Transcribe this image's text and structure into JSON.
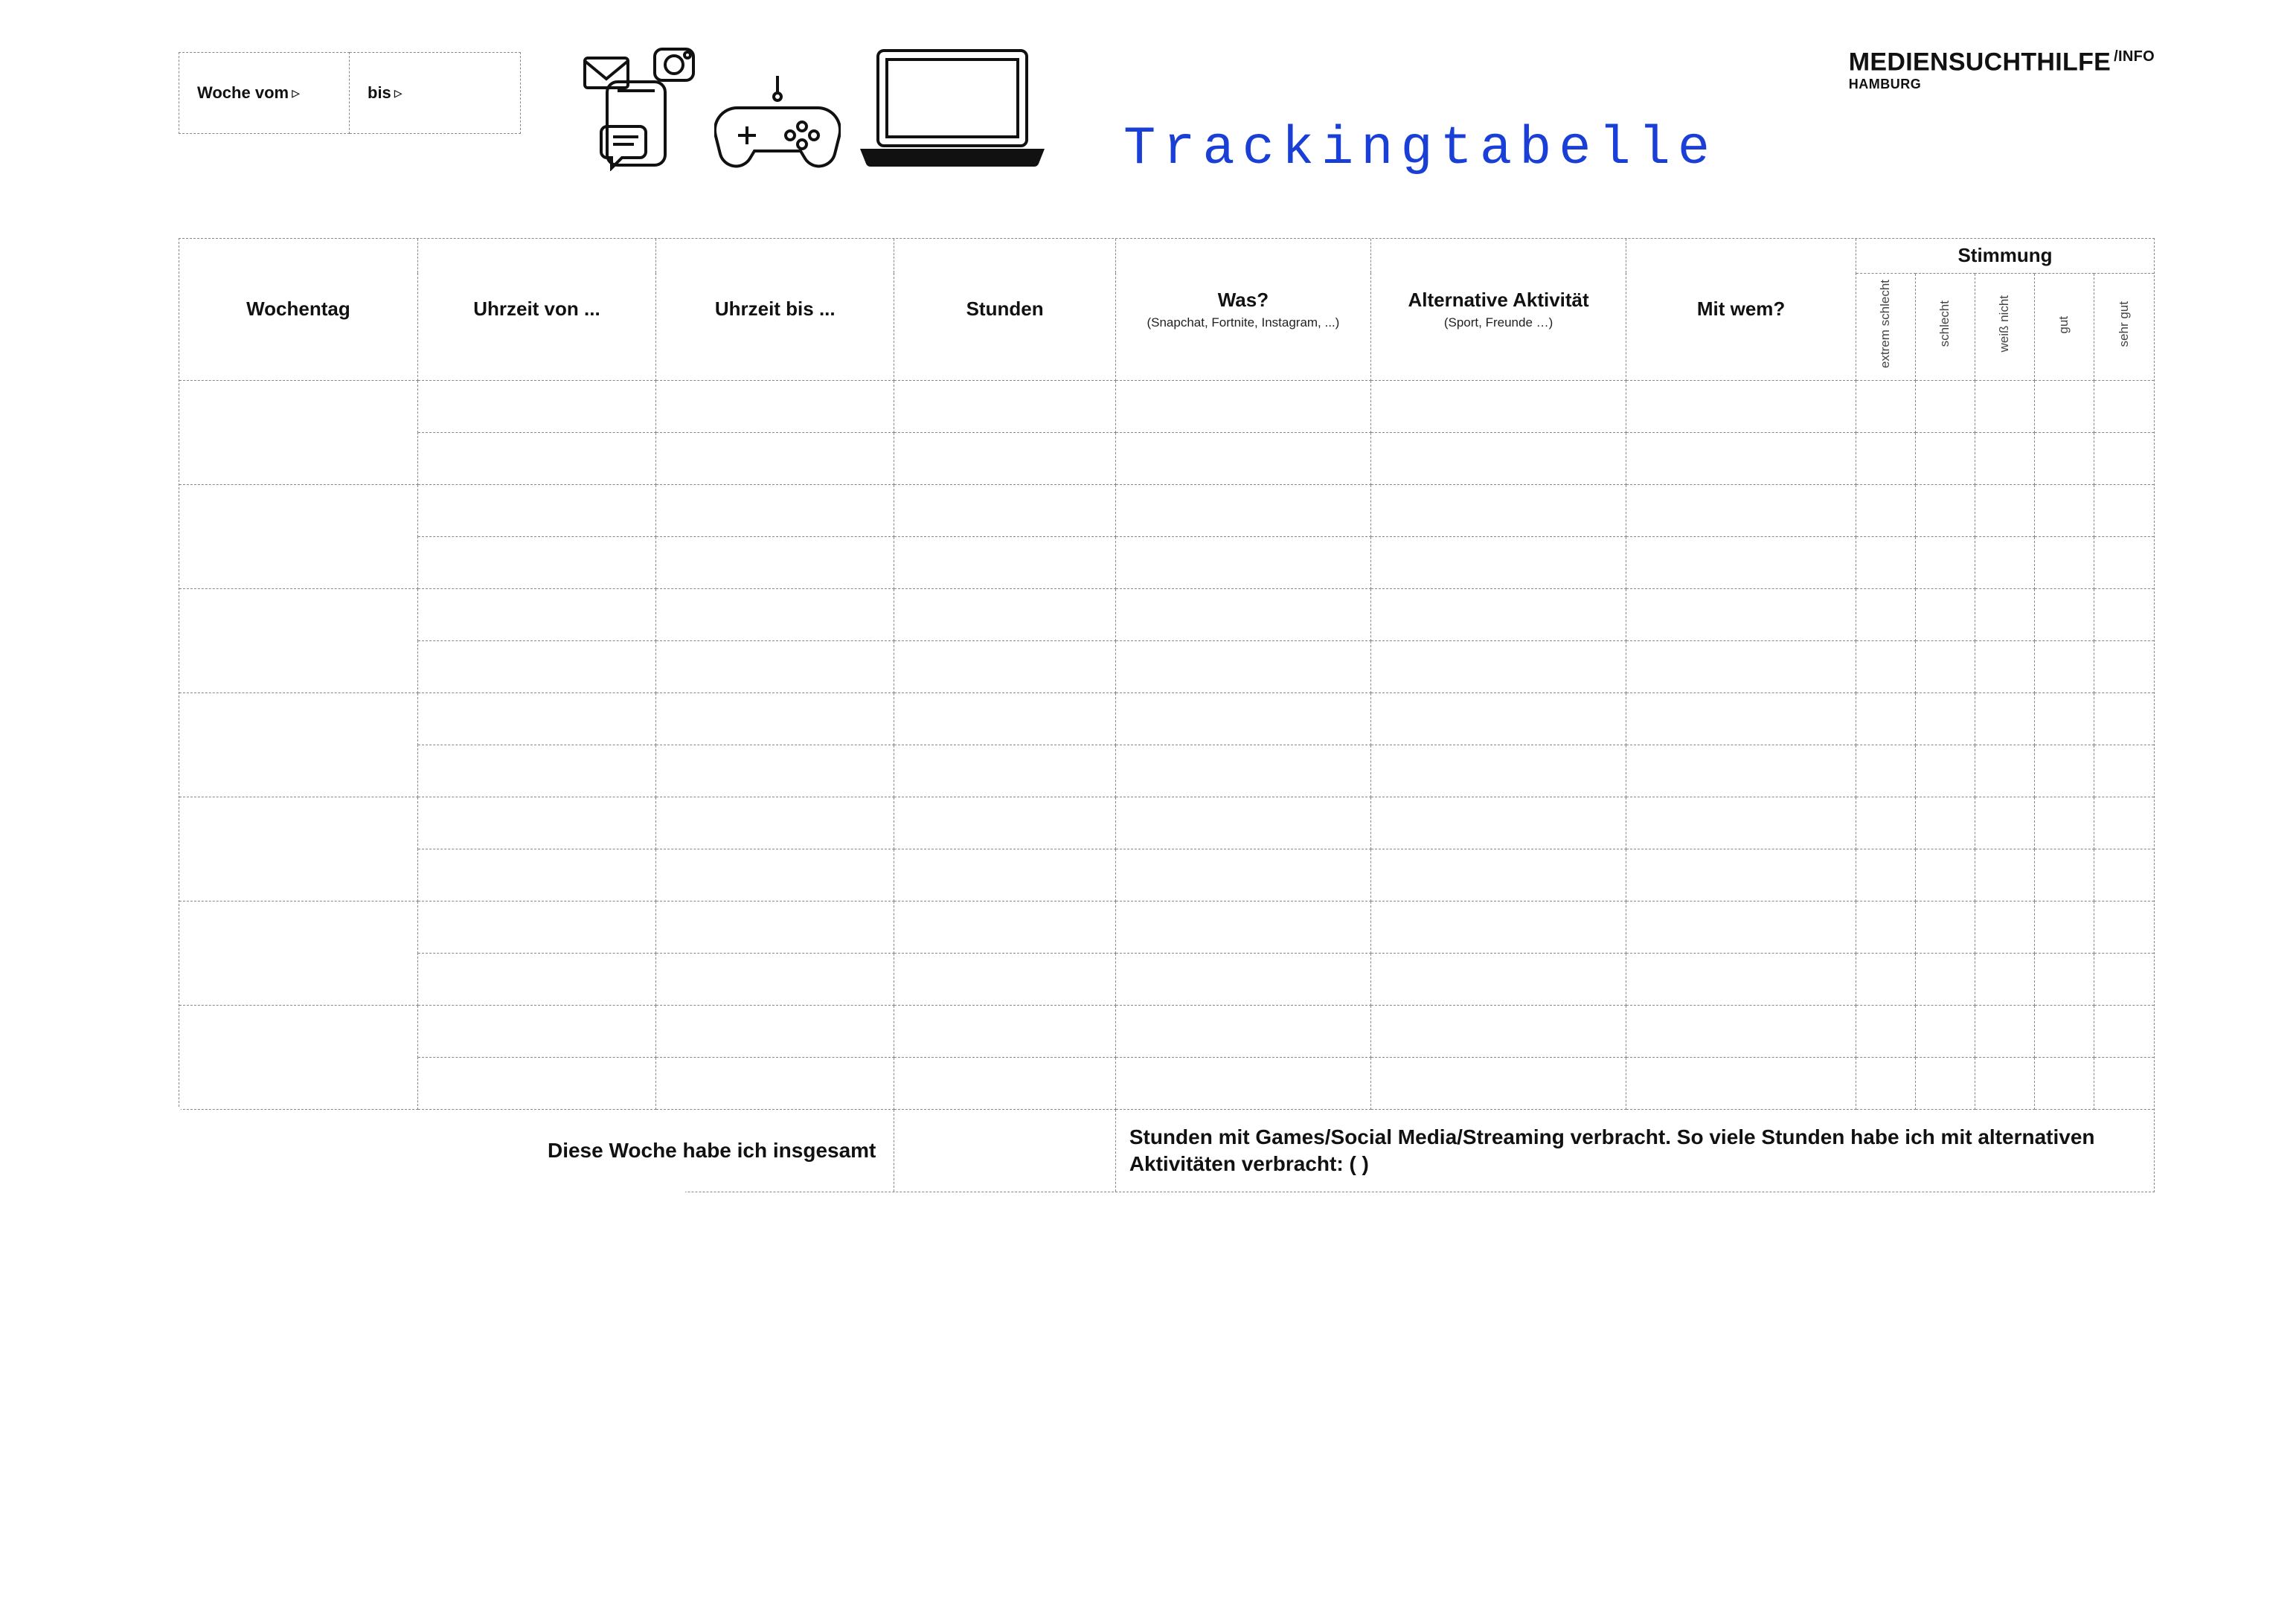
{
  "brand": {
    "name": "MEDIENSUCHTHILFE",
    "suffix": "/INFO",
    "city": "HAMBURG"
  },
  "title": "Trackingtabelle",
  "week": {
    "from_label": "Woche vom",
    "from_arrow": "▹",
    "to_label": "bis",
    "to_arrow": "▹"
  },
  "icons": {
    "phone": "phone-messages-icon",
    "gamepad": "gamepad-icon",
    "laptop": "laptop-icon"
  },
  "columns": {
    "day": "Wochentag",
    "from": "Uhrzeit von ...",
    "to": "Uhrzeit bis ...",
    "hours": "Stunden",
    "what": "Was?",
    "what_sub": "(Snapchat, Fortnite, Instagram, ...)",
    "alt": "Alternative Aktivität",
    "alt_sub": "(Sport, Freunde …)",
    "who": "Mit wem?",
    "mood_group": "Stimmung",
    "mood_levels": [
      "extrem schlecht",
      "schlecht",
      "weiß nicht",
      "gut",
      "sehr gut"
    ]
  },
  "body": {
    "day_rows": 7,
    "sub_rows_per_day": 2
  },
  "footer": {
    "left": "Diese Woche habe ich insgesamt",
    "right": "Stunden mit Games/Social Media/Streaming verbracht. So viele Stunden habe ich mit alternativen Aktivitäten verbracht: (      )"
  }
}
